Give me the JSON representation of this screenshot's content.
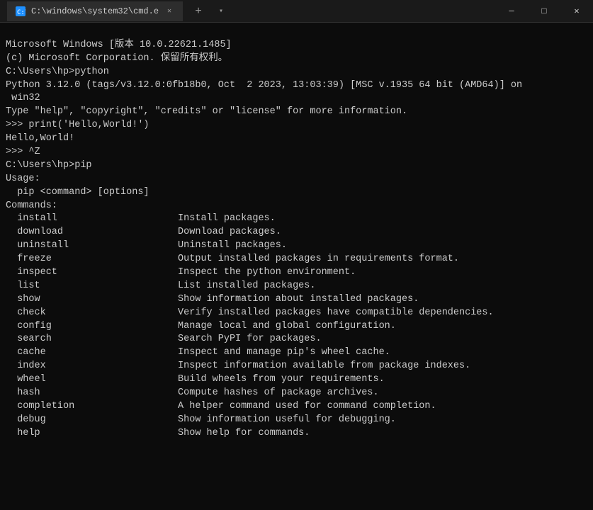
{
  "titlebar": {
    "tab_label": "C:\\windows\\system32\\cmd.e",
    "new_tab_icon": "+",
    "dropdown_icon": "▾",
    "minimize_icon": "─",
    "maximize_icon": "□",
    "close_icon": "✕"
  },
  "terminal": {
    "lines": [
      "Microsoft Windows [版本 10.0.22621.1485]",
      "(c) Microsoft Corporation. 保留所有权利。",
      "",
      "C:\\Users\\hp>python",
      "Python 3.12.0 (tags/v3.12.0:0fb18b0, Oct  2 2023, 13:03:39) [MSC v.1935 64 bit (AMD64)] on",
      " win32",
      "Type \"help\", \"copyright\", \"credits\" or \"license\" for more information.",
      ">>> print('Hello,World!')",
      "Hello,World!",
      ">>> ^Z",
      "",
      "",
      "",
      "C:\\Users\\hp>pip",
      "",
      "Usage:",
      "  pip <command> [options]",
      "",
      "Commands:",
      "  install                     Install packages.",
      "  download                    Download packages.",
      "  uninstall                   Uninstall packages.",
      "  freeze                      Output installed packages in requirements format.",
      "  inspect                     Inspect the python environment.",
      "  list                        List installed packages.",
      "  show                        Show information about installed packages.",
      "  check                       Verify installed packages have compatible dependencies.",
      "  config                      Manage local and global configuration.",
      "  search                      Search PyPI for packages.",
      "  cache                       Inspect and manage pip's wheel cache.",
      "  index                       Inspect information available from package indexes.",
      "  wheel                       Build wheels from your requirements.",
      "  hash                        Compute hashes of package archives.",
      "  completion                  A helper command used for command completion.",
      "  debug                       Show information useful for debugging.",
      "  help                        Show help for commands."
    ]
  }
}
